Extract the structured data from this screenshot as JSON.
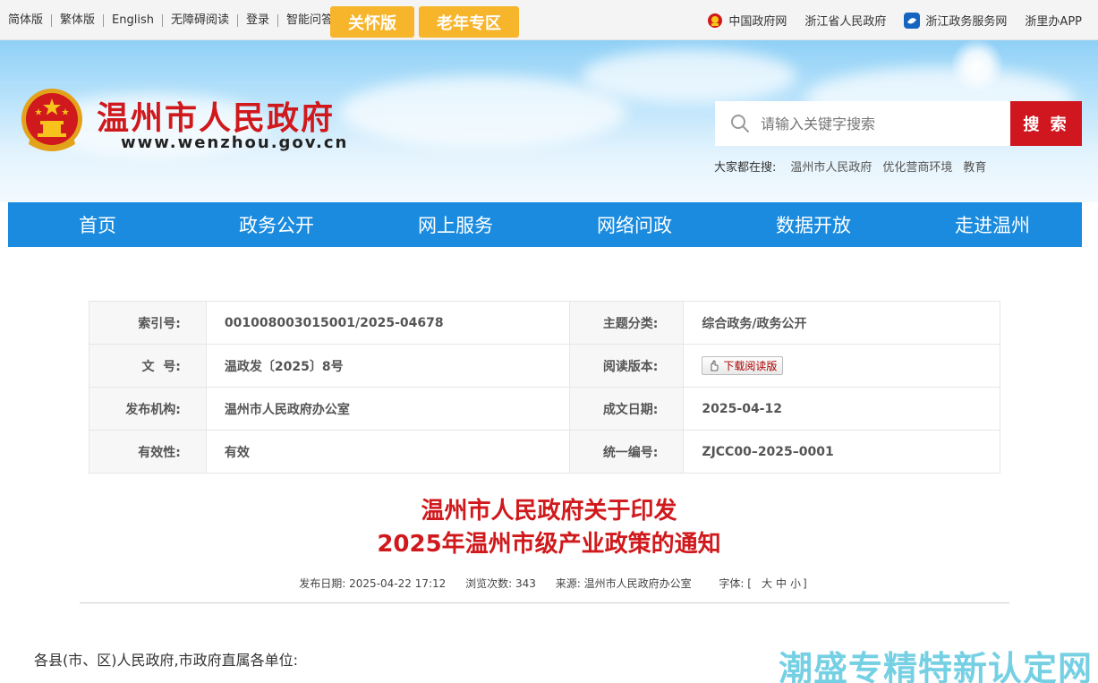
{
  "topbar": {
    "links": [
      "简体版",
      "繁体版",
      "English",
      "无障碍阅读",
      "登录",
      "智能问答"
    ],
    "care_button": "关怀版",
    "elder_button": "老年专区",
    "right_links": [
      "中国政府网",
      "浙江省人民政府",
      "浙江政务服务网",
      "浙里办APP"
    ]
  },
  "header": {
    "site_title": "温州市人民政府",
    "site_url": "www.wenzhou.gov.cn",
    "search_placeholder": "请输入关键字搜索",
    "search_button": "搜 索",
    "hot_label": "大家都在搜:",
    "hot_words": [
      "温州市人民政府",
      "优化营商环境",
      "教育"
    ]
  },
  "nav": [
    "首页",
    "政务公开",
    "网上服务",
    "网络问政",
    "数据开放",
    "走进温州"
  ],
  "info": {
    "index_label": "索引号:",
    "index_value": "001008003015001/2025-04678",
    "topic_label": "主题分类:",
    "topic_value": "综合政务/政务公开",
    "docno_label": "文  号:",
    "docno_value": "温政发〔2025〕8号",
    "reading_label": "阅读版本:",
    "reading_button": "下载阅读版",
    "issuer_label": "发布机构:",
    "issuer_value": "温州市人民政府办公室",
    "date_label": "成文日期:",
    "date_value": "2025-04-12",
    "valid_label": "有效性:",
    "valid_value": "有效",
    "code_label": "统一编号:",
    "code_value": "ZJCC00–2025–0001"
  },
  "article": {
    "title_line1": "温州市人民政府关于印发",
    "title_line2": "2025年温州市级产业政策的通知",
    "meta_date": "发布日期: 2025-04-22 17:12",
    "meta_views": "浏览次数: 343",
    "meta_source": "来源: 温州市人民政府办公室",
    "meta_font_label": "字体: [",
    "font_large": "大",
    "font_medium": "中",
    "font_small": "小",
    "meta_font_end": "]",
    "greeting": "各县(市、区)人民政府,市政府直属各单位:"
  },
  "watermark": "潮盛专精特新认定网",
  "colors": {
    "brand_red": "#d0191c",
    "nav_blue": "#1a8bdf",
    "care_yellow": "#f7b52c"
  }
}
